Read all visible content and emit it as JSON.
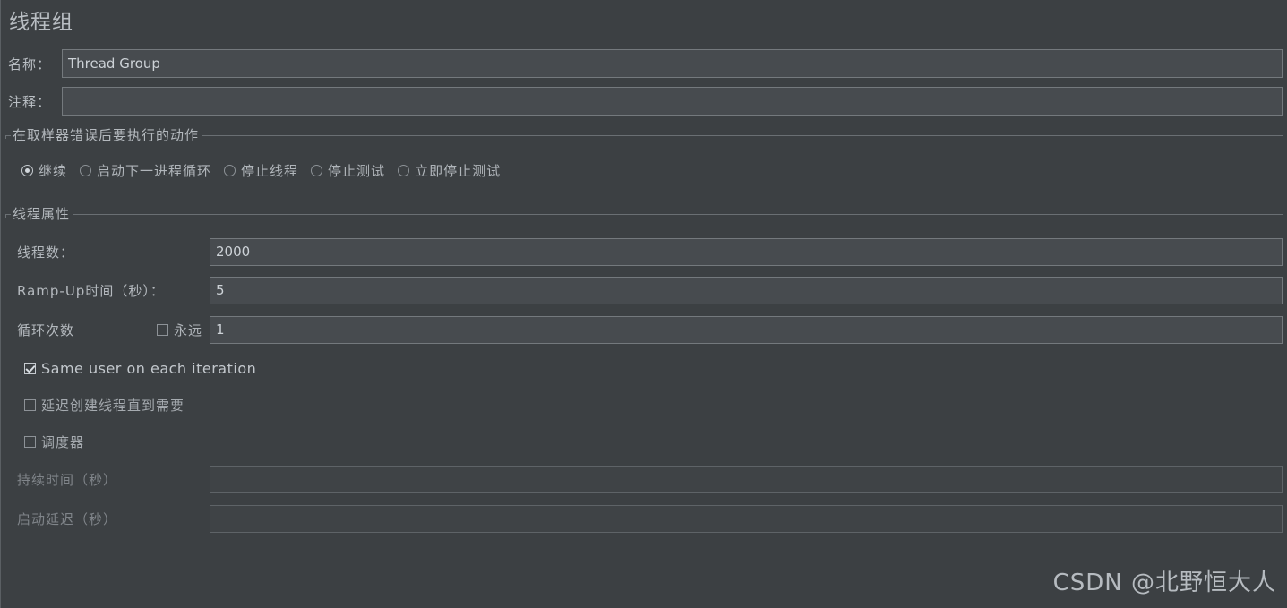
{
  "panel": {
    "title": "线程组"
  },
  "fields": {
    "name_label": "名称：",
    "name_value": "Thread Group",
    "comment_label": "注释：",
    "comment_value": ""
  },
  "error_action_group": {
    "title": "在取样器错误后要执行的动作",
    "options": [
      {
        "label": "继续",
        "selected": true
      },
      {
        "label": "启动下一进程循环",
        "selected": false
      },
      {
        "label": "停止线程",
        "selected": false
      },
      {
        "label": "停止测试",
        "selected": false
      },
      {
        "label": "立即停止测试",
        "selected": false
      }
    ]
  },
  "thread_properties": {
    "title": "线程属性",
    "threads_label": "线程数：",
    "threads_value": "2000",
    "rampup_label": "Ramp-Up时间（秒）：",
    "rampup_value": "5",
    "loops_label": "循环次数",
    "forever_label": "永远",
    "forever_checked": false,
    "loops_value": "1",
    "same_user_label": "Same user on each iteration",
    "same_user_checked": true,
    "delay_create_label": "延迟创建线程直到需要",
    "delay_create_checked": false,
    "scheduler_label": "调度器",
    "scheduler_checked": false,
    "duration_label": "持续时间（秒）",
    "duration_value": "",
    "startup_delay_label": "启动延迟（秒）",
    "startup_delay_value": ""
  },
  "watermark": {
    "text": "CSDN @北野恒大人"
  },
  "colors": {
    "background": "#3c4043",
    "field_background": "#474b4f",
    "field_border": "#74797d",
    "text": "#b9bec3",
    "text_dim": "#80858a"
  }
}
